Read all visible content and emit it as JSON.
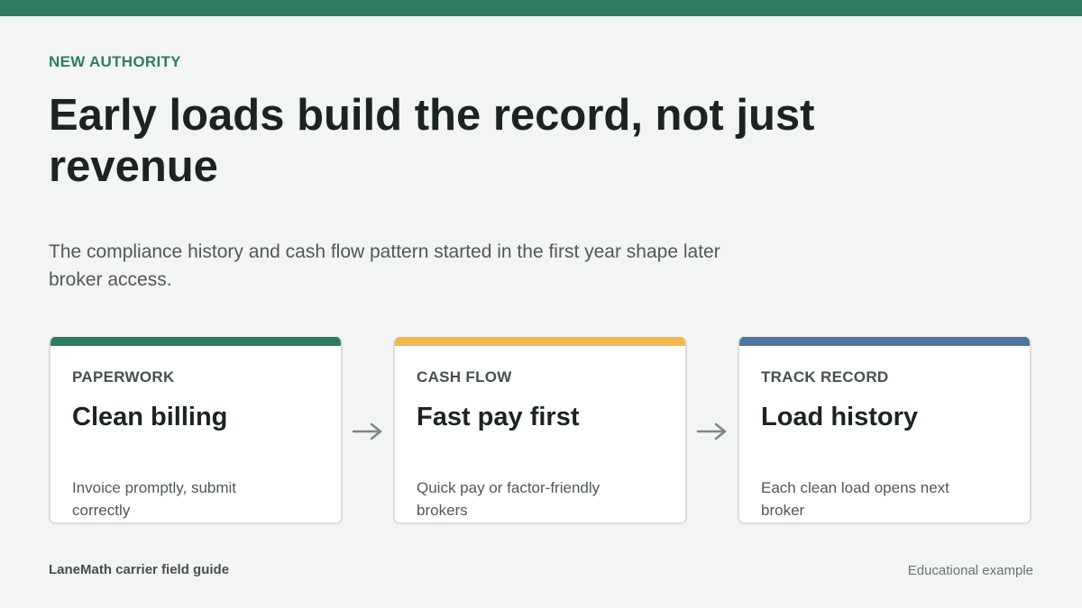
{
  "eyebrow": "NEW AUTHORITY",
  "title": "Early loads build the record, not just revenue",
  "subtitle": "The compliance history and cash flow pattern started in the first year shape later broker access.",
  "cards": [
    {
      "eyebrow": "PAPERWORK",
      "title": "Clean billing",
      "description": "Invoice promptly, submit correctly",
      "accent_color": "#2e7d62"
    },
    {
      "eyebrow": "CASH FLOW",
      "title": "Fast pay first",
      "description": "Quick pay or factor-friendly brokers",
      "accent_color": "#f0b84a"
    },
    {
      "eyebrow": "TRACK RECORD",
      "title": "Load history",
      "description": "Each clean load opens next broker",
      "accent_color": "#4e74a0"
    }
  ],
  "arrow_icon": "arrow-right-icon",
  "footer": {
    "left": "LaneMath carrier field guide",
    "right": "Educational example"
  },
  "colors": {
    "brand": "#2e7d62",
    "background": "#f3f5f4"
  }
}
